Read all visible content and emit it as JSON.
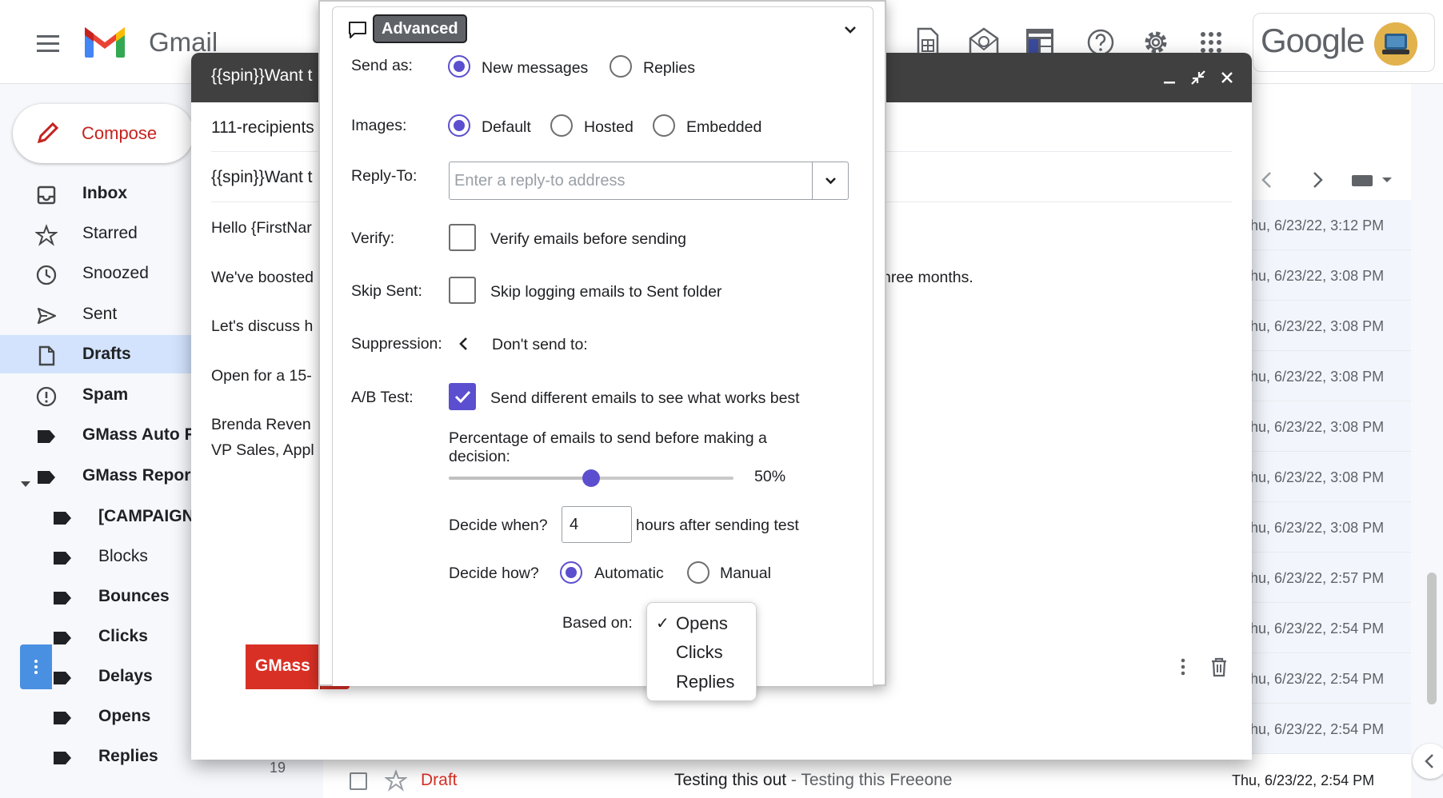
{
  "gmail": {
    "brand": "Gmail",
    "google": "Google",
    "compose_label": "Compose",
    "nav": [
      {
        "label": "Inbox",
        "bold": true,
        "icon": "inbox-icon"
      },
      {
        "label": "Starred",
        "bold": false,
        "icon": "star-icon"
      },
      {
        "label": "Snoozed",
        "bold": false,
        "icon": "clock-icon"
      },
      {
        "label": "Sent",
        "bold": false,
        "icon": "send-icon"
      },
      {
        "label": "Drafts",
        "bold": true,
        "icon": "draft-icon"
      },
      {
        "label": "Spam",
        "bold": true,
        "icon": "spam-icon"
      },
      {
        "label": "GMass Auto F",
        "bold": true,
        "icon": "label-icon"
      },
      {
        "label": "GMass Repor",
        "bold": true,
        "icon": "label-icon"
      },
      {
        "label": "[CAMPAIGN",
        "bold": true,
        "icon": "label-icon"
      },
      {
        "label": "Blocks",
        "bold": false,
        "icon": "label-icon"
      },
      {
        "label": "Bounces",
        "bold": true,
        "icon": "label-icon"
      },
      {
        "label": "Clicks",
        "bold": true,
        "icon": "label-icon"
      },
      {
        "label": "Delays",
        "bold": true,
        "icon": "label-icon"
      },
      {
        "label": "Opens",
        "bold": true,
        "icon": "label-icon"
      },
      {
        "label": "Replies",
        "bold": true,
        "icon": "label-icon"
      }
    ],
    "replies_count": "19",
    "mail_dates": [
      "Thu, 6/23/22, 3:12 PM",
      "Thu, 6/23/22, 3:08 PM",
      "Thu, 6/23/22, 3:08 PM",
      "Thu, 6/23/22, 3:08 PM",
      "Thu, 6/23/22, 3:08 PM",
      "Thu, 6/23/22, 3:08 PM",
      "Thu, 6/23/22, 3:08 PM",
      "Thu, 6/23/22, 2:57 PM",
      "Thu, 6/23/22, 2:54 PM",
      "Thu, 6/23/22, 2:54 PM",
      "Thu, 6/23/22, 2:54 PM"
    ],
    "last_row": {
      "draft": "Draft",
      "subject": "Testing this out",
      "snippet": " - Testing this Freeone",
      "date": "Thu, 6/23/22, 2:54 PM"
    }
  },
  "compose": {
    "header_subject": "{{spin}}Want t",
    "recipients": "111-recipients",
    "subject": "{{spin}}Want t",
    "body": [
      "Hello {FirstNar",
      "We've boosted",
      "Let's discuss h",
      "Open for a 15-",
      "Brenda Reven",
      "VP Sales, Appl"
    ],
    "body_tail": "hree months.",
    "gmass_label": "GMass"
  },
  "advanced": {
    "title": "Advanced",
    "send_as": {
      "label": "Send as:",
      "options": [
        "New messages",
        "Replies"
      ],
      "selected": "New messages"
    },
    "images": {
      "label": "Images:",
      "options": [
        "Default",
        "Hosted",
        "Embedded"
      ],
      "selected": "Default"
    },
    "reply_to": {
      "label": "Reply-To:",
      "placeholder": "Enter a reply-to address",
      "value": ""
    },
    "verify": {
      "label": "Verify:",
      "text": "Verify emails before sending",
      "checked": false
    },
    "skip_sent": {
      "label": "Skip Sent:",
      "text": "Skip logging emails to Sent folder",
      "checked": false
    },
    "suppression": {
      "label": "Suppression:",
      "text": "Don't send to:"
    },
    "ab_test": {
      "label": "A/B Test:",
      "text": "Send different emails to see what works best",
      "checked": true,
      "percentage_label_1": "Percentage of emails to send before making a",
      "percentage_label_2": "decision:",
      "percentage": 50,
      "percentage_text": "50%",
      "decide_when_label": "Decide when?",
      "hours": "4",
      "hours_suffix": "hours after sending test",
      "decide_how_label": "Decide how?",
      "decide_how_options": [
        "Automatic",
        "Manual"
      ],
      "decide_how_selected": "Automatic",
      "based_on_label": "Based on:",
      "based_on_options": [
        "Opens",
        "Clicks",
        "Replies"
      ],
      "based_on_selected": "Opens",
      "check_mark": "✓"
    }
  },
  "colors": {
    "accent": "#5b4fcf",
    "gmass_red": "#d93025",
    "gmass_blue": "#4a90e2",
    "header_dark": "#404040"
  }
}
